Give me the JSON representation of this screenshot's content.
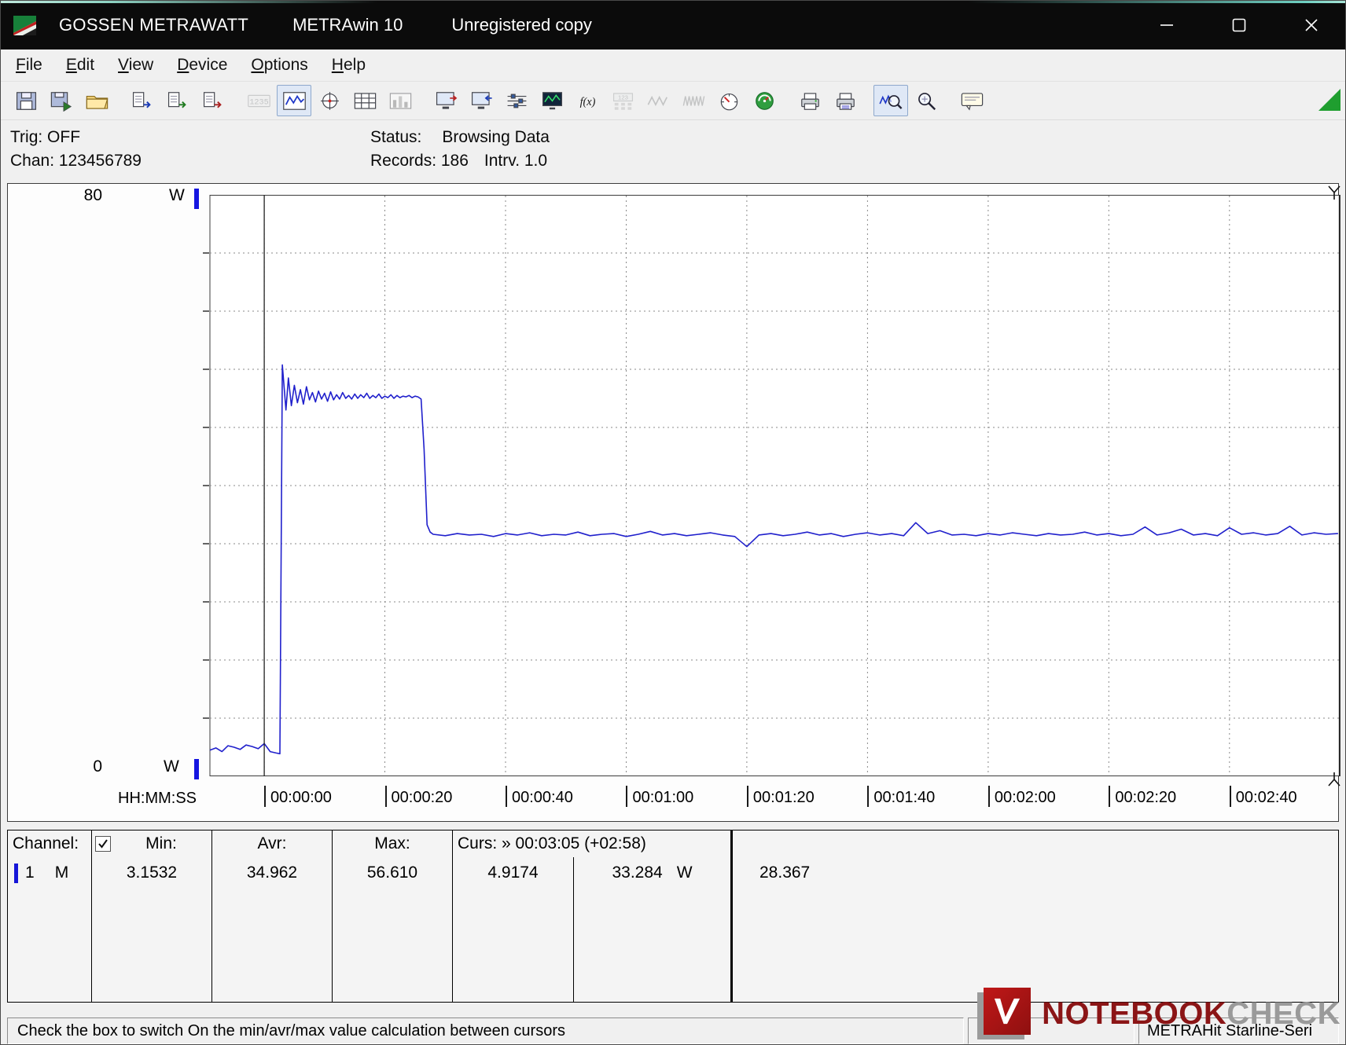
{
  "titlebar": {
    "app": "GOSSEN METRAWATT",
    "product": "METRAwin 10",
    "note": "Unregistered copy"
  },
  "menu": {
    "items": [
      "File",
      "Edit",
      "View",
      "Device",
      "Options",
      "Help"
    ]
  },
  "toolbar": {
    "buttons": [
      {
        "name": "save",
        "kind": "floppy",
        "enabled": true,
        "pressed": false,
        "sep": false
      },
      {
        "name": "save-as",
        "kind": "floppy2",
        "enabled": true,
        "pressed": false,
        "sep": false
      },
      {
        "name": "open",
        "kind": "folder",
        "enabled": true,
        "pressed": false,
        "sep": true
      },
      {
        "name": "export-data",
        "kind": "docarrow",
        "enabled": true,
        "pressed": false,
        "sep": false
      },
      {
        "name": "export-screen",
        "kind": "docarrow2",
        "enabled": true,
        "pressed": false,
        "sep": false
      },
      {
        "name": "export-report",
        "kind": "docarrow3",
        "enabled": true,
        "pressed": false,
        "sep": true
      },
      {
        "name": "numeric-display",
        "kind": "lcd",
        "enabled": false,
        "pressed": false,
        "sep": false
      },
      {
        "name": "trend-view",
        "kind": "curve",
        "enabled": true,
        "pressed": true,
        "sep": false
      },
      {
        "name": "xy-view",
        "kind": "crosshair",
        "enabled": true,
        "pressed": false,
        "sep": false
      },
      {
        "name": "table-view",
        "kind": "grid",
        "enabled": true,
        "pressed": false,
        "sep": false
      },
      {
        "name": "bargraph-view",
        "kind": "bars",
        "enabled": false,
        "pressed": false,
        "sep": true
      },
      {
        "name": "device-settings",
        "kind": "monitor-out",
        "enabled": true,
        "pressed": false,
        "sep": false
      },
      {
        "name": "device-read",
        "kind": "monitor-in",
        "enabled": true,
        "pressed": false,
        "sep": false
      },
      {
        "name": "channel-setup",
        "kind": "sliders",
        "enabled": true,
        "pressed": false,
        "sep": false
      },
      {
        "name": "live-monitor",
        "kind": "monitor-dark",
        "enabled": true,
        "pressed": false,
        "sep": false
      },
      {
        "name": "formula",
        "kind": "fx",
        "enabled": true,
        "pressed": false,
        "sep": false
      },
      {
        "name": "calculator",
        "kind": "lcd-small",
        "enabled": false,
        "pressed": false,
        "sep": false
      },
      {
        "name": "waveform-a",
        "kind": "wave",
        "enabled": false,
        "pressed": false,
        "sep": false
      },
      {
        "name": "waveform-b",
        "kind": "wave2",
        "enabled": false,
        "pressed": false,
        "sep": false
      },
      {
        "name": "analog-meter",
        "kind": "gauge",
        "enabled": true,
        "pressed": false,
        "sep": false
      },
      {
        "name": "status-meter",
        "kind": "gauge-green",
        "enabled": true,
        "pressed": false,
        "sep": true
      },
      {
        "name": "print",
        "kind": "printer",
        "enabled": true,
        "pressed": false,
        "sep": false
      },
      {
        "name": "print-preview",
        "kind": "printer2",
        "enabled": true,
        "pressed": false,
        "sep": true
      },
      {
        "name": "zoom-curve",
        "kind": "zoomwave",
        "enabled": true,
        "pressed": true,
        "sep": false
      },
      {
        "name": "zoom",
        "kind": "zoom",
        "enabled": true,
        "pressed": false,
        "sep": true
      },
      {
        "name": "annotation",
        "kind": "note",
        "enabled": true,
        "pressed": false,
        "sep": false
      }
    ]
  },
  "info": {
    "trig": "Trig: OFF",
    "chan": "Chan: 123456789",
    "status_label": "Status:",
    "status_value": "Browsing Data",
    "records": "Records: 186",
    "interval": "Intrv. 1.0"
  },
  "chart_data": {
    "type": "line",
    "title": "",
    "xlabel": "HH:MM:SS",
    "ylabel": "W",
    "ylim": [
      0,
      80
    ],
    "xlim_seconds": [
      -9,
      178.4
    ],
    "y_axis_top_label": "80",
    "y_axis_bottom_label": "0",
    "y_axis_unit": "W",
    "y_gridline_step": 8,
    "grid": true,
    "x_ticks_seconds": [
      0,
      20,
      40,
      60,
      80,
      100,
      120,
      140,
      160
    ],
    "x_tick_labels": [
      "00:00:00",
      "00:00:20",
      "00:00:40",
      "00:01:00",
      "00:01:20",
      "00:01:40",
      "00:02:00",
      "00:02:20",
      "00:02:40"
    ],
    "cursors_seconds": [
      0,
      178.4
    ],
    "series": [
      {
        "name": "Channel 1 (W)",
        "color": "#2020cc",
        "points": [
          [
            -9,
            3.6
          ],
          [
            -8,
            3.9
          ],
          [
            -7,
            3.4
          ],
          [
            -6,
            4.2
          ],
          [
            -5,
            4.0
          ],
          [
            -4,
            3.7
          ],
          [
            -3,
            4.3
          ],
          [
            -2,
            4.1
          ],
          [
            -1,
            3.8
          ],
          [
            0,
            4.5
          ],
          [
            1,
            3.4
          ],
          [
            2,
            3.2
          ],
          [
            2.6,
            3.1
          ],
          [
            3,
            56.6
          ],
          [
            3.6,
            50.4
          ],
          [
            4,
            54.8
          ],
          [
            4.5,
            51.0
          ],
          [
            5,
            53.8
          ],
          [
            5.5,
            51.4
          ],
          [
            6,
            53.2
          ],
          [
            6.5,
            51.2
          ],
          [
            7,
            53.6
          ],
          [
            7.5,
            51.8
          ],
          [
            8,
            52.8
          ],
          [
            8.5,
            51.5
          ],
          [
            9,
            53.0
          ],
          [
            9.5,
            51.9
          ],
          [
            10,
            52.7
          ],
          [
            10.5,
            51.6
          ],
          [
            11,
            52.9
          ],
          [
            11.5,
            51.8
          ],
          [
            12,
            52.5
          ],
          [
            12.5,
            51.9
          ],
          [
            13,
            52.8
          ],
          [
            13.5,
            52.0
          ],
          [
            14,
            52.4
          ],
          [
            14.5,
            51.9
          ],
          [
            15,
            52.6
          ],
          [
            15.5,
            52.0
          ],
          [
            16,
            52.5
          ],
          [
            16.5,
            52.1
          ],
          [
            17,
            52.7
          ],
          [
            17.5,
            52.0
          ],
          [
            18,
            52.4
          ],
          [
            18.5,
            52.1
          ],
          [
            19,
            52.6
          ],
          [
            19.5,
            52.0
          ],
          [
            20,
            52.3
          ],
          [
            20.5,
            52.1
          ],
          [
            21,
            52.5
          ],
          [
            21.5,
            52.0
          ],
          [
            22,
            52.4
          ],
          [
            22.5,
            52.1
          ],
          [
            23,
            52.3
          ],
          [
            23.5,
            52.2
          ],
          [
            24,
            52.4
          ],
          [
            24.5,
            52.1
          ],
          [
            25,
            52.3
          ],
          [
            25.5,
            52.2
          ],
          [
            26,
            51.9
          ],
          [
            26.5,
            45.0
          ],
          [
            27,
            34.6
          ],
          [
            27.5,
            33.6
          ],
          [
            28,
            33.3
          ],
          [
            30,
            33.1
          ],
          [
            32,
            33.4
          ],
          [
            34,
            33.2
          ],
          [
            36,
            33.3
          ],
          [
            38,
            33.0
          ],
          [
            40,
            33.4
          ],
          [
            42,
            33.2
          ],
          [
            44,
            33.5
          ],
          [
            46,
            33.1
          ],
          [
            48,
            33.3
          ],
          [
            50,
            33.2
          ],
          [
            52,
            33.6
          ],
          [
            54,
            33.1
          ],
          [
            56,
            33.3
          ],
          [
            58,
            33.4
          ],
          [
            60,
            33.0
          ],
          [
            62,
            33.3
          ],
          [
            64,
            33.7
          ],
          [
            66,
            33.2
          ],
          [
            68,
            33.4
          ],
          [
            70,
            33.1
          ],
          [
            72,
            33.3
          ],
          [
            74,
            33.5
          ],
          [
            76,
            33.2
          ],
          [
            78,
            33.0
          ],
          [
            80,
            31.6
          ],
          [
            82,
            33.2
          ],
          [
            84,
            33.4
          ],
          [
            86,
            33.1
          ],
          [
            88,
            33.3
          ],
          [
            90,
            33.6
          ],
          [
            92,
            33.2
          ],
          [
            94,
            33.4
          ],
          [
            96,
            33.0
          ],
          [
            98,
            33.3
          ],
          [
            100,
            33.5
          ],
          [
            102,
            33.2
          ],
          [
            104,
            33.4
          ],
          [
            106,
            33.1
          ],
          [
            108,
            34.9
          ],
          [
            110,
            33.4
          ],
          [
            112,
            33.8
          ],
          [
            114,
            33.2
          ],
          [
            116,
            33.3
          ],
          [
            118,
            33.1
          ],
          [
            120,
            33.4
          ],
          [
            122,
            33.2
          ],
          [
            124,
            33.5
          ],
          [
            126,
            33.3
          ],
          [
            128,
            33.1
          ],
          [
            130,
            33.4
          ],
          [
            132,
            33.2
          ],
          [
            134,
            33.3
          ],
          [
            136,
            33.6
          ],
          [
            138,
            33.2
          ],
          [
            140,
            33.4
          ],
          [
            142,
            33.1
          ],
          [
            144,
            33.3
          ],
          [
            146,
            34.3
          ],
          [
            148,
            33.2
          ],
          [
            150,
            33.5
          ],
          [
            152,
            34.0
          ],
          [
            154,
            33.2
          ],
          [
            156,
            33.4
          ],
          [
            158,
            33.1
          ],
          [
            160,
            34.2
          ],
          [
            162,
            33.3
          ],
          [
            164,
            33.5
          ],
          [
            166,
            33.2
          ],
          [
            168,
            33.4
          ],
          [
            170,
            34.4
          ],
          [
            172,
            33.2
          ],
          [
            174,
            33.5
          ],
          [
            176,
            33.3
          ],
          [
            178,
            33.4
          ]
        ]
      }
    ]
  },
  "table": {
    "headers": {
      "channel": "Channel:",
      "min": "Min:",
      "avr": "Avr:",
      "max": "Max:",
      "curs": "Curs: » 00:03:05 (+02:58)"
    },
    "checkbox_checked": true,
    "row": {
      "channel_num": "1",
      "channel_mode": "M",
      "min": "3.1532",
      "avr": "34.962",
      "max": "56.610",
      "curs_a": "4.9174",
      "curs_b": "33.284",
      "curs_b_unit": "W",
      "curs_delta": "28.367",
      "channel_color": "#1515d8"
    }
  },
  "statusbar": {
    "hint": "Check the box to switch On the min/avr/max value calculation between cursors",
    "device": "METRAHit Starline-Seri"
  },
  "watermark": {
    "word1": "NOTEBOOK",
    "word2": "CHECK"
  }
}
